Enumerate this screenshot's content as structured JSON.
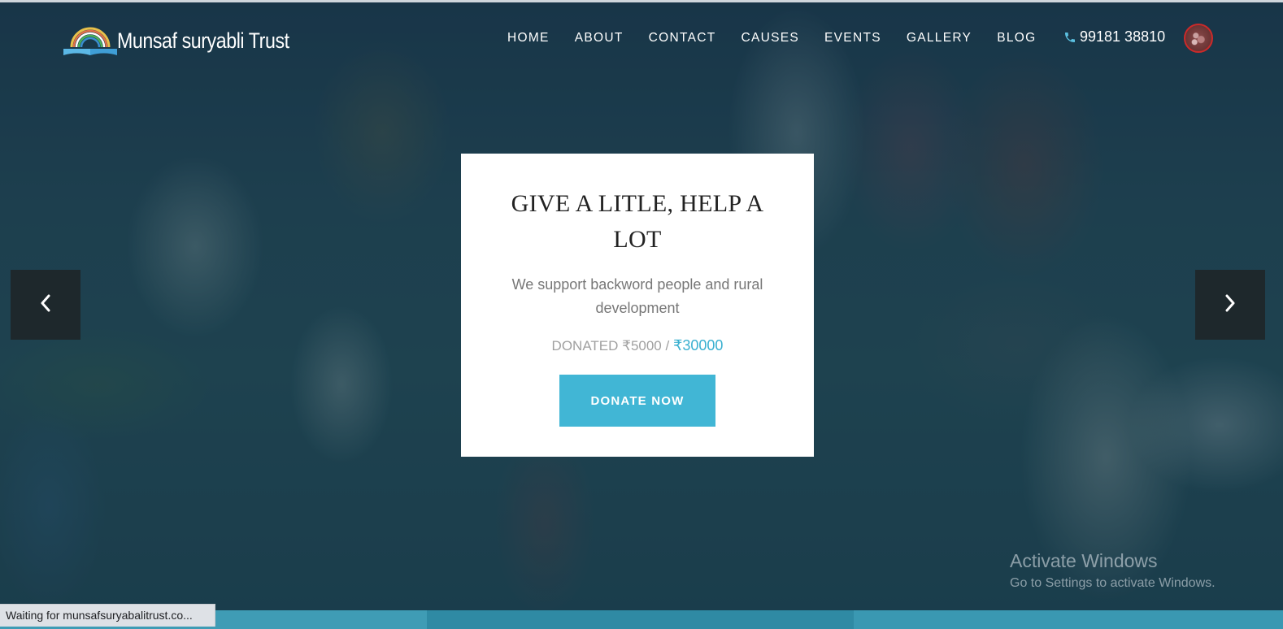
{
  "header": {
    "logo_text": "Munsaf suryabli Trust",
    "nav": [
      "HOME",
      "ABOUT",
      "CONTACT",
      "CAUSES",
      "EVENTS",
      "GALLERY",
      "BLOG"
    ],
    "phone": "99181 38810"
  },
  "hero": {
    "title": "GIVE A LITLE, HELP A LOT",
    "subtitle": "We support backword people and rural development",
    "donated_label": "DONATED ₹5000 / ",
    "goal": "₹30000",
    "button_label": "DONATE NOW"
  },
  "watermark": {
    "title": "Activate Windows",
    "subtitle": "Go to Settings to activate Windows."
  },
  "status_bar": {
    "text": "Waiting for munsafsuryabalitrust.co..."
  },
  "colors": {
    "accent": "#41b6d5",
    "goal_text": "#3ab0d0",
    "overlay": "#0e3246"
  },
  "icons": {
    "logo": "rising-sun-book-icon",
    "phone": "phone-icon",
    "prev": "chevron-left-icon",
    "next": "chevron-right-icon"
  }
}
